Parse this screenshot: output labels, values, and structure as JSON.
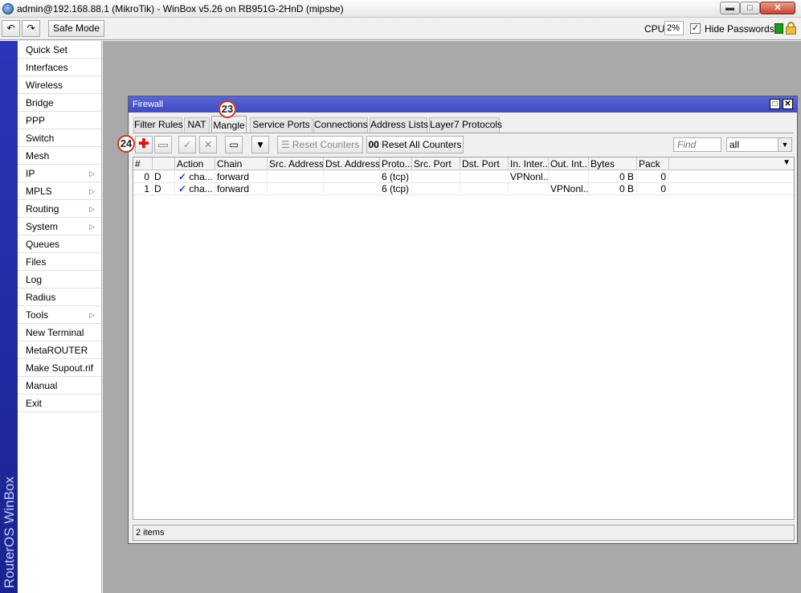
{
  "window": {
    "title": "admin@192.168.88.1 (MikroTik) - WinBox v5.26 on RB951G-2HnD (mipsbe)",
    "min_glyph": "▬",
    "max_glyph": "□",
    "close_glyph": "✕"
  },
  "toolbar": {
    "undo_glyph": "↶",
    "redo_glyph": "↷",
    "safe_mode_label": "Safe Mode",
    "cpu_label": "CPU:",
    "cpu_value": "2%",
    "hide_passwords_label": "Hide Passwords",
    "hide_passwords_checked": "✓"
  },
  "brand": {
    "text": "RouterOS WinBox"
  },
  "sidebar": {
    "items": [
      {
        "label": "Quick Set"
      },
      {
        "label": "Interfaces"
      },
      {
        "label": "Wireless"
      },
      {
        "label": "Bridge"
      },
      {
        "label": "PPP"
      },
      {
        "label": "Switch"
      },
      {
        "label": "Mesh"
      },
      {
        "label": "IP"
      },
      {
        "label": "MPLS"
      },
      {
        "label": "Routing"
      },
      {
        "label": "System"
      },
      {
        "label": "Queues"
      },
      {
        "label": "Files"
      },
      {
        "label": "Log"
      },
      {
        "label": "Radius"
      },
      {
        "label": "Tools"
      },
      {
        "label": "New Terminal"
      },
      {
        "label": "MetaROUTER"
      },
      {
        "label": "Make Supout.rif"
      },
      {
        "label": "Manual"
      },
      {
        "label": "Exit"
      }
    ],
    "submenu_arrow": "▷"
  },
  "firewall": {
    "title": "Firewall",
    "max_glyph": "□",
    "close_glyph": "✕",
    "tabs": [
      {
        "label": "Filter Rules"
      },
      {
        "label": "NAT"
      },
      {
        "label": "Mangle"
      },
      {
        "label": "Service Ports"
      },
      {
        "label": "Connections"
      },
      {
        "label": "Address Lists"
      },
      {
        "label": "Layer7 Protocols"
      }
    ],
    "callouts": [
      "23",
      "24"
    ],
    "buttons": {
      "add_glyph": "✚",
      "enable_glyph": "✓",
      "disable_glyph": "✕",
      "comment_glyph": "▭",
      "filter_glyph": "▼",
      "reset_counters_label": "Reset Counters",
      "reset_counters_glyph": "☰",
      "reset_all_counters_label": "Reset All Counters",
      "reset_all_counters_glyph": "00"
    },
    "find_placeholder": "Find",
    "filter_select_value": "all",
    "dropdown_glyph": "▼",
    "columns": [
      "#",
      "",
      "Action",
      "Chain",
      "Src. Address",
      "Dst. Address",
      "Proto...",
      "Src. Port",
      "Dst. Port",
      "In. Inter...",
      "Out. Int...",
      "Bytes",
      "Pack"
    ],
    "rows": [
      {
        "num": "0",
        "flag": "D",
        "action": "cha...",
        "chain": "forward",
        "src": "",
        "dst": "",
        "proto": "6 (tcp)",
        "sport": "",
        "dport": "",
        "in_iface": "VPNonl...",
        "out_iface": "",
        "bytes": "0 B",
        "packets": "0"
      },
      {
        "num": "1",
        "flag": "D",
        "action": "cha...",
        "chain": "forward",
        "src": "",
        "dst": "",
        "proto": "6 (tcp)",
        "sport": "",
        "dport": "",
        "in_iface": "",
        "out_iface": "VPNonl...",
        "bytes": "0 B",
        "packets": "0"
      }
    ],
    "action_check_glyph": "✓",
    "status": "2 items"
  }
}
